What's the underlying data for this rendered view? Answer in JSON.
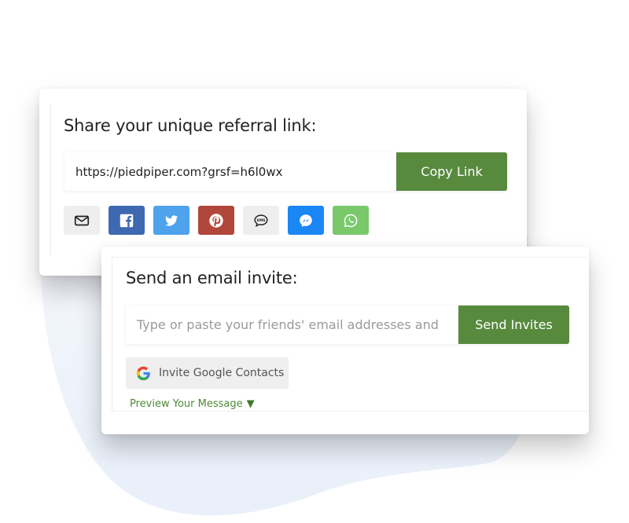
{
  "referral": {
    "title": "Share your unique referral link:",
    "link_value": "https://piedpiper.com?grsf=h6l0wx",
    "copy_label": "Copy Link",
    "share_buttons": [
      {
        "id": "email",
        "icon": "envelope-icon",
        "color": "#eeeeee"
      },
      {
        "id": "facebook",
        "icon": "facebook-icon",
        "color": "#3e69b0"
      },
      {
        "id": "twitter",
        "icon": "twitter-icon",
        "color": "#4ea3ec"
      },
      {
        "id": "pinterest",
        "icon": "pinterest-icon",
        "color": "#b1473a"
      },
      {
        "id": "sms",
        "icon": "sms-icon",
        "color": "#eeeeee"
      },
      {
        "id": "messenger",
        "icon": "messenger-icon",
        "color": "#1a87f5"
      },
      {
        "id": "whatsapp",
        "icon": "whatsapp-icon",
        "color": "#79c96b"
      }
    ]
  },
  "email_invite": {
    "title": "Send an email invite:",
    "input_placeholder": "Type or paste your friends' email addresses and",
    "send_label": "Send Invites",
    "google_label": "Invite Google Contacts",
    "preview_label": "Preview Your Message",
    "preview_toggle_icon": "▼"
  },
  "colors": {
    "accent_green": "#588a3e",
    "link_green": "#4e8a35",
    "blob_background": "#eef3fb"
  }
}
